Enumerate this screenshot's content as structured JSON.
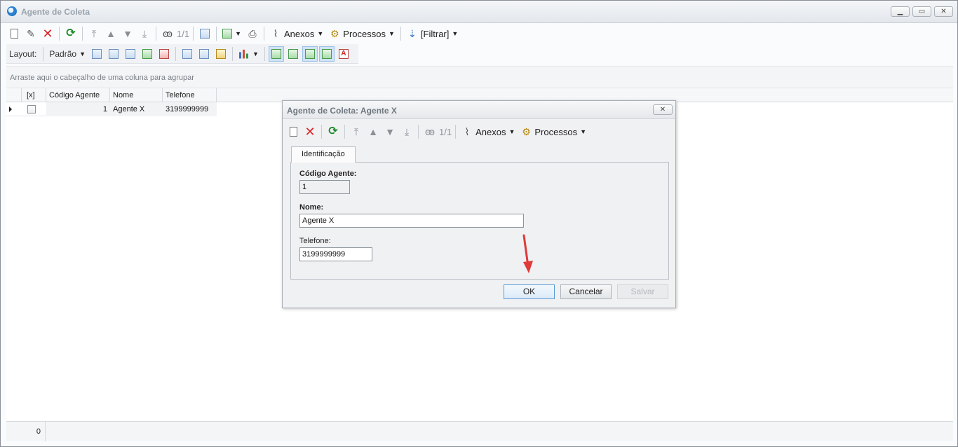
{
  "window": {
    "title": "Agente de Coleta",
    "controls": {
      "minimize": "▁",
      "restore": "▭",
      "close": "✕"
    }
  },
  "toolbar1": {
    "counter": "1/1",
    "anexos": "Anexos",
    "processos": "Processos",
    "filtrar": "[Filtrar]"
  },
  "toolbar2": {
    "layout_label": "Layout:",
    "padrao": "Padrão"
  },
  "group_hint": "Arraste aqui o cabeçalho de uma coluna para agrupar",
  "grid": {
    "columns": [
      "[x]",
      "Código Agente",
      "Nome",
      "Telefone"
    ],
    "rows": [
      {
        "codigo": "1",
        "nome": "Agente X",
        "telefone": "3199999999"
      }
    ]
  },
  "footer": {
    "count": "0"
  },
  "dialog": {
    "title": "Agente de Coleta: Agente X",
    "close": "✕",
    "counter": "1/1",
    "anexos": "Anexos",
    "processos": "Processos",
    "tab": "Identificação",
    "fields": {
      "codigo_label": "Código Agente:",
      "codigo_value": "1",
      "nome_label": "Nome:",
      "nome_value": "Agente X",
      "telefone_label": "Telefone:",
      "telefone_value": "3199999999"
    },
    "buttons": {
      "ok": "OK",
      "cancelar": "Cancelar",
      "salvar": "Salvar"
    }
  },
  "icons": {
    "new": "new-document-icon",
    "edit": "edit-icon",
    "delete": "delete-icon",
    "refresh": "refresh-icon",
    "first": "first-record-icon",
    "prev": "previous-record-icon",
    "next": "next-record-icon",
    "last": "last-record-icon",
    "find": "binoculars-icon",
    "calendar": "calendar-icon",
    "export": "export-icon",
    "print": "print-icon",
    "attach": "paperclip-icon",
    "process": "gears-icon",
    "filter": "filter-icon"
  },
  "colors": {
    "accent_red": "#dd2222",
    "refresh_green": "#1a8a2a",
    "arrow_red": "#e03a3a",
    "ok_border": "#5b9bd5"
  }
}
